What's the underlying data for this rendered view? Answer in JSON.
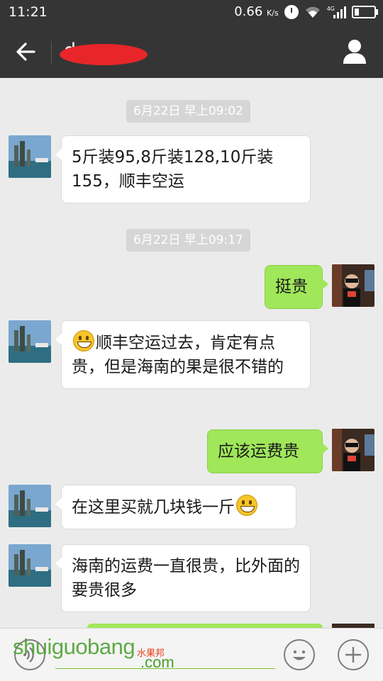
{
  "status_bar": {
    "time": "11:21",
    "net_speed": "0.66",
    "net_speed_unit": "K/s",
    "network_type": "4G"
  },
  "header": {
    "title": "dy.....ra",
    "back_icon": "arrow-left-icon",
    "profile_icon": "person-icon"
  },
  "timestamps": [
    "6月22日 早上09:02",
    "6月22日 早上09:17"
  ],
  "messages": [
    {
      "side": "in",
      "text": "5斤装95,8斤装128,10斤装155，顺丰空运"
    },
    {
      "side": "out",
      "text": "挺贵"
    },
    {
      "side": "in",
      "emoji_start": "grinning-face",
      "text": "顺丰空运过去，肯定有点贵，但是海南的果是很不错的"
    },
    {
      "side": "out",
      "text": "应该运费贵"
    },
    {
      "side": "in",
      "text": "在这里买就几块钱一斤",
      "emoji_end": "grinning-face"
    },
    {
      "side": "in",
      "text": "海南的运费一直很贵，比外面的要贵很多"
    }
  ],
  "input_bar": {
    "placeholder": "",
    "voice_icon": "voice-icon",
    "emoji_icon": "emoji-icon",
    "plus_icon": "plus-icon"
  },
  "watermark": {
    "text": "shuiguobang",
    "suffix": ".com",
    "chinese": "水果邦"
  },
  "colors": {
    "header_bg": "#353535",
    "chat_bg": "#ebebeb",
    "outgoing_bubble": "#a0e75a",
    "incoming_bubble": "#ffffff",
    "timestamp_bg": "#d6d6d6"
  }
}
